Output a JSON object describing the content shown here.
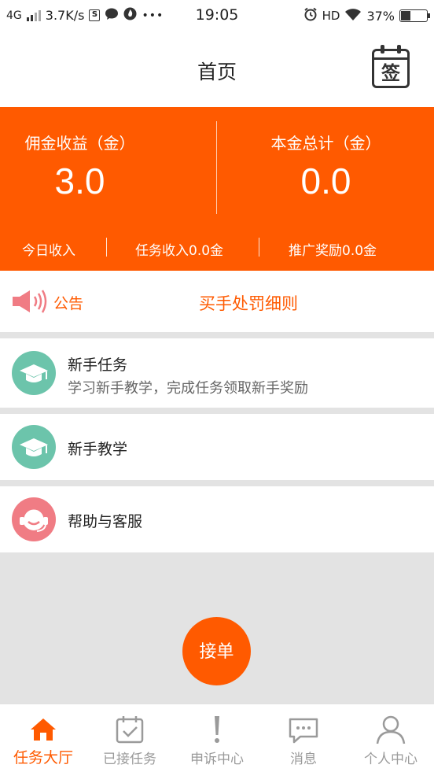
{
  "status_bar": {
    "network": "4G",
    "speed": "3.7K/s",
    "time": "19:05",
    "hd": "HD",
    "battery": "37%",
    "s_badge": "S",
    "dots": "•••"
  },
  "header": {
    "title": "首页",
    "sign_label": "签"
  },
  "earnings": {
    "commission_label": "佣金收益（金）",
    "commission_value": "3.0",
    "principal_label": "本金总计（金）",
    "principal_value": "0.0",
    "today_income": "今日收入",
    "task_income": "任务收入0.0金",
    "promo_reward": "推广奖励0.0金"
  },
  "notice": {
    "label": "公告",
    "text": "买手处罚细则"
  },
  "menu": [
    {
      "title": "新手任务",
      "subtitle": "学习新手教学，完成任务领取新手奖励",
      "icon": "graduation-cap-icon"
    },
    {
      "title": "新手教学",
      "icon": "graduation-cap-icon"
    },
    {
      "title": "帮助与客服",
      "icon": "customer-service-icon"
    }
  ],
  "order_button": "接单",
  "tabs": [
    {
      "label": "任务大厅",
      "icon": "home-icon",
      "active": true
    },
    {
      "label": "已接任务",
      "icon": "calendar-check-icon",
      "active": false
    },
    {
      "label": "申诉中心",
      "icon": "exclamation-icon",
      "active": false
    },
    {
      "label": "消息",
      "icon": "message-icon",
      "active": false
    },
    {
      "label": "个人中心",
      "icon": "person-icon",
      "active": false
    }
  ],
  "colors": {
    "accent": "#ff5a00",
    "teal_icon": "#6cc4ab",
    "pink_icon": "#f07c84",
    "inactive_tab": "#9a9a9a",
    "background_grey": "#e3e3e3"
  }
}
